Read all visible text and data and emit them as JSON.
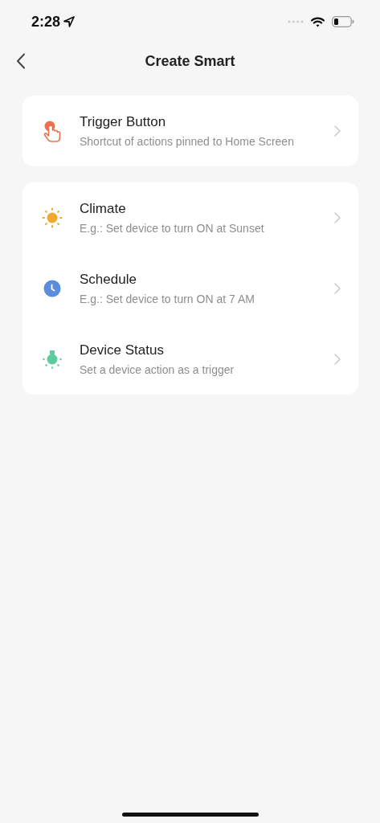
{
  "status_bar": {
    "time": "2:28"
  },
  "nav": {
    "title": "Create Smart"
  },
  "groups": [
    {
      "items": [
        {
          "kind": "tap",
          "title": "Trigger Button",
          "subtitle": "Shortcut of actions pinned to Home Screen"
        }
      ]
    },
    {
      "items": [
        {
          "kind": "sun",
          "title": "Climate",
          "subtitle": "E.g.: Set device to turn ON at Sunset"
        },
        {
          "kind": "clock",
          "title": "Schedule",
          "subtitle": "E.g.: Set device to turn ON at 7 AM"
        },
        {
          "kind": "bulb",
          "title": "Device Status",
          "subtitle": "Set a device action as a trigger"
        }
      ]
    }
  ]
}
